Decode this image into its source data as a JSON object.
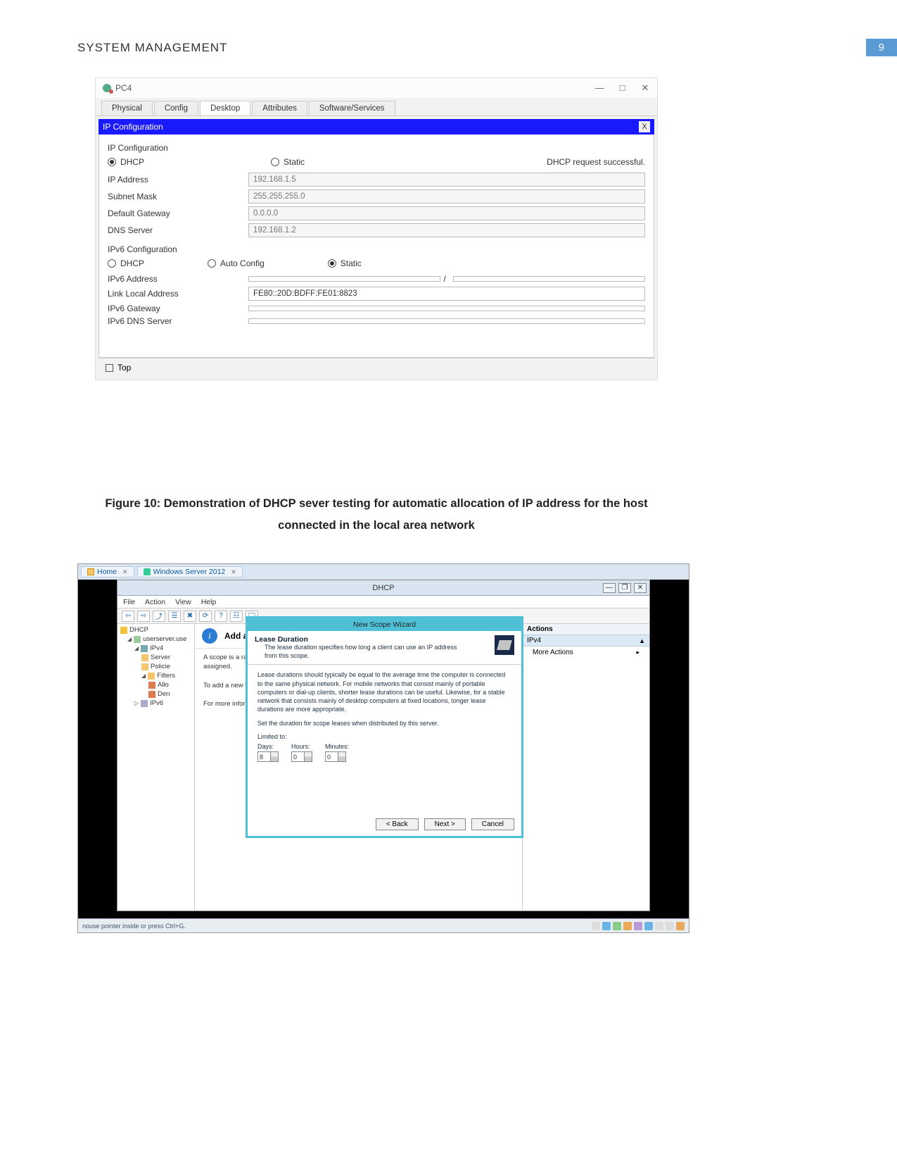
{
  "page": {
    "header_title": "SYSTEM MANAGEMENT",
    "page_number": "9"
  },
  "caption": "Figure 10: Demonstration of DHCP sever testing for automatic allocation of IP address for the host connected in the local area network",
  "pt": {
    "title": "PC4",
    "tabs": [
      "Physical",
      "Config",
      "Desktop",
      "Attributes",
      "Software/Services"
    ],
    "active_tab": "Desktop",
    "panel_title": "IP Configuration",
    "section1_label": "IP Configuration",
    "ipv4_mode_dhcp": "DHCP",
    "ipv4_mode_static": "Static",
    "dhcp_status": "DHCP request successful.",
    "fields": {
      "ip_address_label": "IP Address",
      "ip_address": "192.168.1.5",
      "subnet_label": "Subnet Mask",
      "subnet": "255.255.255.0",
      "gateway_label": "Default Gateway",
      "gateway": "0.0.0.0",
      "dns_label": "DNS Server",
      "dns": "192.168.1.2"
    },
    "section2_label": "IPv6 Configuration",
    "ipv6_modes": {
      "dhcp": "DHCP",
      "auto": "Auto Config",
      "static": "Static"
    },
    "ipv6_fields": {
      "addr_label": "IPv6 Address",
      "addr": "",
      "prefix_label": "/",
      "prefix": "",
      "lla_label": "Link Local Address",
      "lla": "FE80::20D:BDFF:FE01:8823",
      "gw_label": "IPv6 Gateway",
      "gw": "",
      "dns_label": "IPv6 DNS Server",
      "dns": ""
    },
    "footer_top": "Top"
  },
  "ws": {
    "outer_tabs": {
      "home": "Home",
      "server": "Windows Server 2012"
    },
    "window_title": "DHCP",
    "menus": [
      "File",
      "Action",
      "View",
      "Help"
    ],
    "tree": {
      "root": "DHCP",
      "server": "userserver.use",
      "ipv4": "IPv4",
      "ipv4_children": [
        "Server",
        "Policie",
        "Filters",
        "Allo",
        "Den"
      ],
      "ipv6": "IPv6"
    },
    "midpanel": {
      "title": "Add a Scope",
      "desc": "A scope is a range of IP addresses and configure a scope before dynamic IP addresses can be assigned.\n\nTo add a new scope, on the Action menu, click New Scope.\n\nFor more information about setting up a DHCP server, see online Help."
    },
    "actions": {
      "header": "Actions",
      "row": "IPv4",
      "sub": "More Actions"
    },
    "wizard": {
      "title": "New Scope Wizard",
      "head_title": "Lease Duration",
      "head_sub": "The lease duration specifies how long a client can use an IP address from this scope.",
      "para1": "Lease durations should typically be equal to the average time the computer is connected to the same physical network. For mobile networks that consist mainly of portable computers or dial-up clients, shorter lease durations can be useful. Likewise, for a stable network that consists mainly of desktop computers at fixed locations, longer lease durations are more appropriate.",
      "para2": "Set the duration for scope leases when distributed by this server.",
      "limited": "Limited to:",
      "days_label": "Days:",
      "days": "8",
      "hours_label": "Hours:",
      "hours": "0",
      "minutes_label": "Minutes:",
      "minutes": "0",
      "btn_back": "< Back",
      "btn_next": "Next >",
      "btn_cancel": "Cancel"
    },
    "status_left": "nouse pointer inside or press Ctrl+G."
  }
}
